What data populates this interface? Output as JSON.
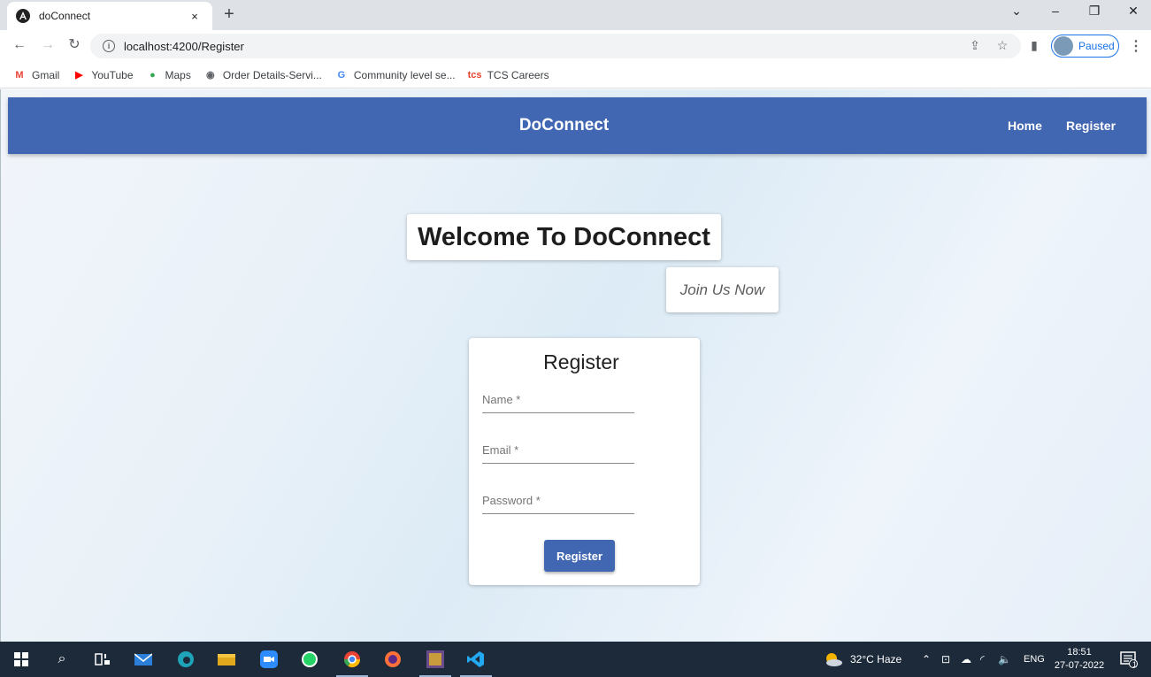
{
  "browser": {
    "tab_title": "doConnect",
    "tab_close": "×",
    "new_tab": "+",
    "url": "localhost:4200/Register",
    "profile_status": "Paused",
    "window_controls": {
      "minimize": "–",
      "restore": "❐",
      "close": "✕",
      "tab_search": "⌄"
    }
  },
  "bookmarks": [
    {
      "label": "Gmail",
      "icon": "gmail-icon",
      "glyph": "M",
      "color": "#ea4335"
    },
    {
      "label": "YouTube",
      "icon": "youtube-icon",
      "glyph": "▶",
      "color": "#ff0000"
    },
    {
      "label": "Maps",
      "icon": "maps-icon",
      "glyph": "●",
      "color": "#34a853"
    },
    {
      "label": "Order Details-Servi...",
      "icon": "globe-icon",
      "glyph": "◉",
      "color": "#5f6368"
    },
    {
      "label": "Community level se...",
      "icon": "google-icon",
      "glyph": "G",
      "color": "#4285f4"
    },
    {
      "label": "TCS Careers",
      "icon": "tcs-icon",
      "glyph": "tcs",
      "color": "#e8442e"
    }
  ],
  "app": {
    "brand": "DoConnect",
    "nav": {
      "home": "Home",
      "register": "Register"
    },
    "welcome": "Welcome To DoConnect",
    "tagline": "Join Us Now",
    "form": {
      "title": "Register",
      "name_placeholder": "Name *",
      "email_placeholder": "Email *",
      "password_placeholder": "Password *",
      "submit_label": "Register"
    },
    "colors": {
      "primary": "#4166b2"
    }
  },
  "taskbar": {
    "weather": "32°C  Haze",
    "language": "ENG",
    "time": "18:51",
    "date": "27-07-2022",
    "notification_count": "1"
  }
}
